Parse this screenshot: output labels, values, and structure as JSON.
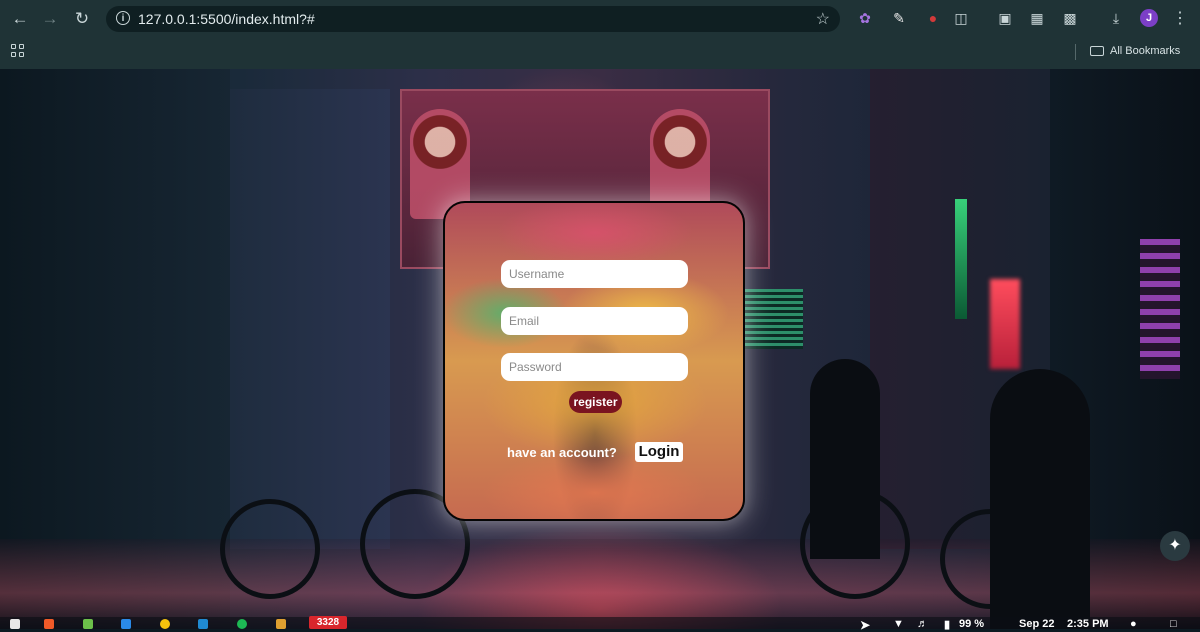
{
  "browser": {
    "url": "127.0.0.1:5500/index.html?#",
    "bookmarks_label": "All Bookmarks",
    "profile_initial": "J",
    "icons": {
      "back": "back-arrow-icon",
      "forward": "forward-arrow-icon",
      "reload": "reload-icon",
      "info": "site-info-icon",
      "star": "bookmark-star-icon",
      "downloads": "download-icon",
      "apps": "apps-grid-icon",
      "folder": "folder-icon",
      "menu": "more-vert-icon"
    }
  },
  "form": {
    "username_placeholder": "Username",
    "email_placeholder": "Email",
    "password_placeholder": "Password",
    "register_label": "register",
    "have_account_text": "have an account?",
    "login_label": "Login"
  },
  "taskbar": {
    "badge_count": "3328",
    "battery": "99 %",
    "date": "Sep 22",
    "time": "2:35 PM"
  },
  "colors": {
    "chrome_bg": "#1f3336",
    "register_bg": "#7a1420",
    "badge_bg": "#d9262c",
    "profile_bg": "#7c3fc7"
  }
}
